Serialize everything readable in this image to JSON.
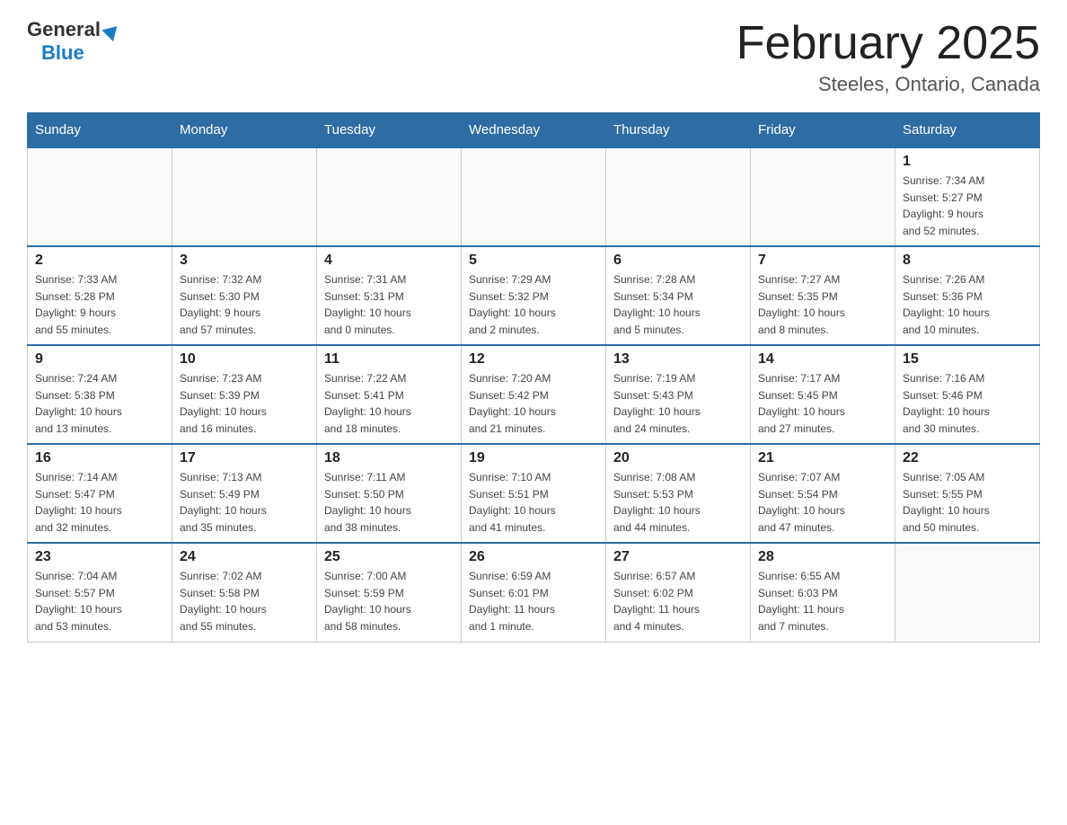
{
  "header": {
    "logo_general": "General",
    "logo_blue": "Blue",
    "month_title": "February 2025",
    "location": "Steeles, Ontario, Canada"
  },
  "weekdays": [
    "Sunday",
    "Monday",
    "Tuesday",
    "Wednesday",
    "Thursday",
    "Friday",
    "Saturday"
  ],
  "weeks": [
    [
      {
        "day": "",
        "info": ""
      },
      {
        "day": "",
        "info": ""
      },
      {
        "day": "",
        "info": ""
      },
      {
        "day": "",
        "info": ""
      },
      {
        "day": "",
        "info": ""
      },
      {
        "day": "",
        "info": ""
      },
      {
        "day": "1",
        "info": "Sunrise: 7:34 AM\nSunset: 5:27 PM\nDaylight: 9 hours\nand 52 minutes."
      }
    ],
    [
      {
        "day": "2",
        "info": "Sunrise: 7:33 AM\nSunset: 5:28 PM\nDaylight: 9 hours\nand 55 minutes."
      },
      {
        "day": "3",
        "info": "Sunrise: 7:32 AM\nSunset: 5:30 PM\nDaylight: 9 hours\nand 57 minutes."
      },
      {
        "day": "4",
        "info": "Sunrise: 7:31 AM\nSunset: 5:31 PM\nDaylight: 10 hours\nand 0 minutes."
      },
      {
        "day": "5",
        "info": "Sunrise: 7:29 AM\nSunset: 5:32 PM\nDaylight: 10 hours\nand 2 minutes."
      },
      {
        "day": "6",
        "info": "Sunrise: 7:28 AM\nSunset: 5:34 PM\nDaylight: 10 hours\nand 5 minutes."
      },
      {
        "day": "7",
        "info": "Sunrise: 7:27 AM\nSunset: 5:35 PM\nDaylight: 10 hours\nand 8 minutes."
      },
      {
        "day": "8",
        "info": "Sunrise: 7:26 AM\nSunset: 5:36 PM\nDaylight: 10 hours\nand 10 minutes."
      }
    ],
    [
      {
        "day": "9",
        "info": "Sunrise: 7:24 AM\nSunset: 5:38 PM\nDaylight: 10 hours\nand 13 minutes."
      },
      {
        "day": "10",
        "info": "Sunrise: 7:23 AM\nSunset: 5:39 PM\nDaylight: 10 hours\nand 16 minutes."
      },
      {
        "day": "11",
        "info": "Sunrise: 7:22 AM\nSunset: 5:41 PM\nDaylight: 10 hours\nand 18 minutes."
      },
      {
        "day": "12",
        "info": "Sunrise: 7:20 AM\nSunset: 5:42 PM\nDaylight: 10 hours\nand 21 minutes."
      },
      {
        "day": "13",
        "info": "Sunrise: 7:19 AM\nSunset: 5:43 PM\nDaylight: 10 hours\nand 24 minutes."
      },
      {
        "day": "14",
        "info": "Sunrise: 7:17 AM\nSunset: 5:45 PM\nDaylight: 10 hours\nand 27 minutes."
      },
      {
        "day": "15",
        "info": "Sunrise: 7:16 AM\nSunset: 5:46 PM\nDaylight: 10 hours\nand 30 minutes."
      }
    ],
    [
      {
        "day": "16",
        "info": "Sunrise: 7:14 AM\nSunset: 5:47 PM\nDaylight: 10 hours\nand 32 minutes."
      },
      {
        "day": "17",
        "info": "Sunrise: 7:13 AM\nSunset: 5:49 PM\nDaylight: 10 hours\nand 35 minutes."
      },
      {
        "day": "18",
        "info": "Sunrise: 7:11 AM\nSunset: 5:50 PM\nDaylight: 10 hours\nand 38 minutes."
      },
      {
        "day": "19",
        "info": "Sunrise: 7:10 AM\nSunset: 5:51 PM\nDaylight: 10 hours\nand 41 minutes."
      },
      {
        "day": "20",
        "info": "Sunrise: 7:08 AM\nSunset: 5:53 PM\nDaylight: 10 hours\nand 44 minutes."
      },
      {
        "day": "21",
        "info": "Sunrise: 7:07 AM\nSunset: 5:54 PM\nDaylight: 10 hours\nand 47 minutes."
      },
      {
        "day": "22",
        "info": "Sunrise: 7:05 AM\nSunset: 5:55 PM\nDaylight: 10 hours\nand 50 minutes."
      }
    ],
    [
      {
        "day": "23",
        "info": "Sunrise: 7:04 AM\nSunset: 5:57 PM\nDaylight: 10 hours\nand 53 minutes."
      },
      {
        "day": "24",
        "info": "Sunrise: 7:02 AM\nSunset: 5:58 PM\nDaylight: 10 hours\nand 55 minutes."
      },
      {
        "day": "25",
        "info": "Sunrise: 7:00 AM\nSunset: 5:59 PM\nDaylight: 10 hours\nand 58 minutes."
      },
      {
        "day": "26",
        "info": "Sunrise: 6:59 AM\nSunset: 6:01 PM\nDaylight: 11 hours\nand 1 minute."
      },
      {
        "day": "27",
        "info": "Sunrise: 6:57 AM\nSunset: 6:02 PM\nDaylight: 11 hours\nand 4 minutes."
      },
      {
        "day": "28",
        "info": "Sunrise: 6:55 AM\nSunset: 6:03 PM\nDaylight: 11 hours\nand 7 minutes."
      },
      {
        "day": "",
        "info": ""
      }
    ]
  ]
}
